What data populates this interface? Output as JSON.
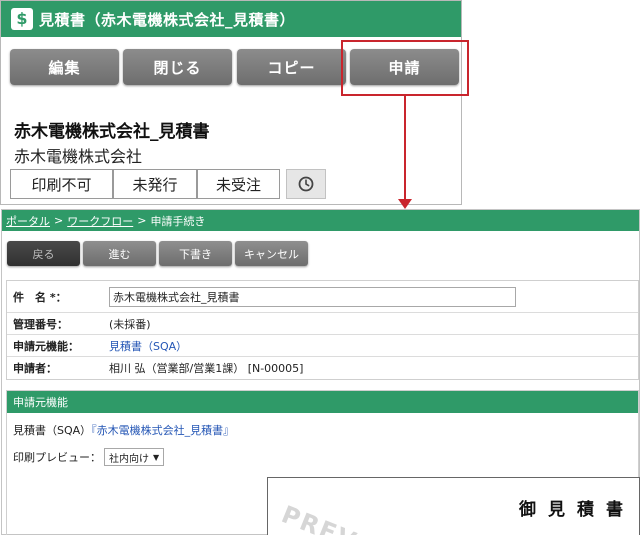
{
  "top": {
    "app_icon_glyph": "$",
    "title": "見積書（赤木電機株式会社_見積書）",
    "buttons": {
      "edit": "編集",
      "close": "閉じる",
      "copy": "コピー",
      "apply": "申請"
    },
    "doc_title": "赤木電機株式会社_見積書",
    "company": "赤木電機株式会社",
    "status": {
      "print": "印刷不可",
      "issue": "未発行",
      "order": "未受注",
      "clock_icon": "clock-icon"
    }
  },
  "breadcrumb": {
    "portal": "ポータル",
    "sep1": ">",
    "workflow": "ワークフロー",
    "sep2": ">",
    "current": "申請手続き"
  },
  "actions": {
    "back": "戻る",
    "next": "進む",
    "draft": "下書き",
    "cancel": "キャンセル"
  },
  "form": {
    "subject_label": "件　名 *：",
    "subject_value": "赤木電機株式会社_見積書",
    "mgmt_label": "管理番号：",
    "mgmt_value": "(未採番)",
    "source_label": "申請元機能：",
    "source_value": "見積書（SQA）",
    "applicant_label": "申請者：",
    "applicant_value": "相川 弘（営業部/営業1課） [N-00005]"
  },
  "source_section": {
    "header": "申請元機能",
    "line_prefix": "見積書（SQA）",
    "line_link": "『赤木電機株式会社_見積書』",
    "preview_label": "印刷プレビュー：",
    "preview_option": "社内向け",
    "watermark": "PREV",
    "preview_doc_title": "御見積書"
  },
  "colors": {
    "accent": "#2f9a68",
    "highlight": "#c9252d",
    "button": "#7d7d7d"
  }
}
